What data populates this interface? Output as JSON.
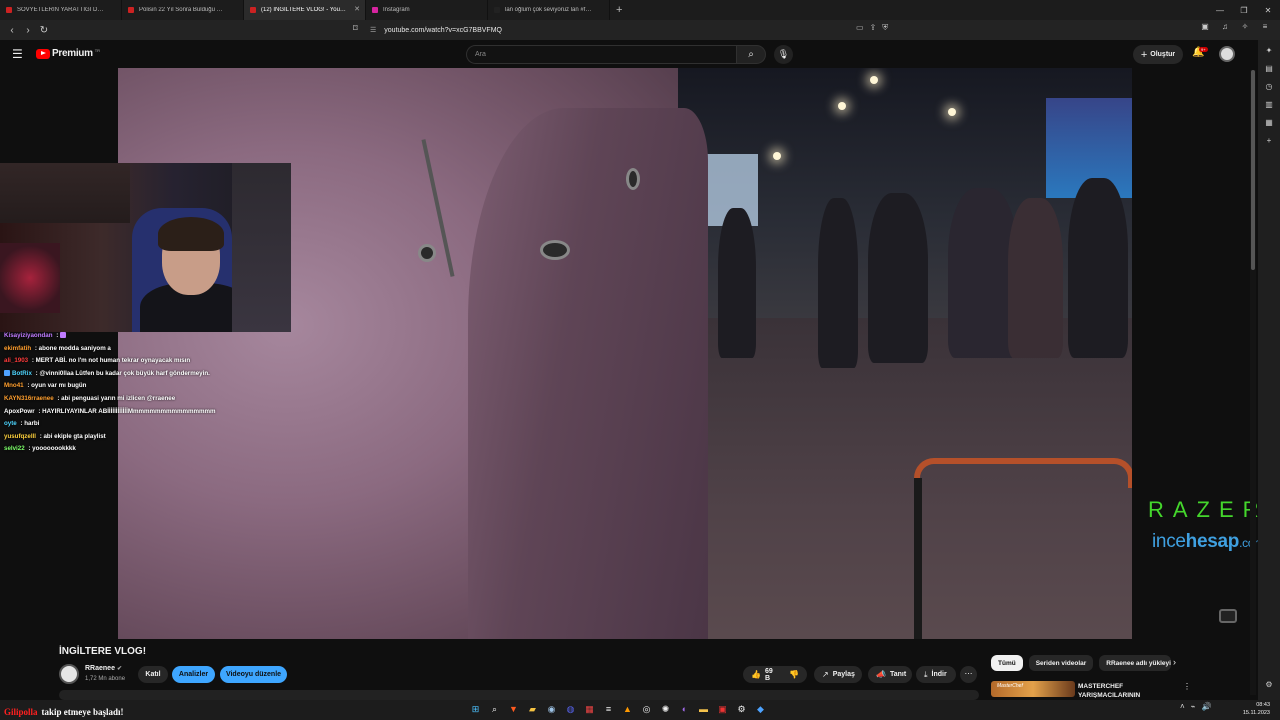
{
  "browser": {
    "tabs": [
      {
        "title": "SOVYETLERİN YARATTIĞI DÜNYANIN...",
        "color": "#cc2222",
        "active": false
      },
      {
        "title": "Polisin 22 Yıl Sonra Bulduğu Gerçek ...",
        "color": "#cc2222",
        "active": false
      },
      {
        "title": "(12) İNGİLTERE VLOG! - YouTube",
        "color": "#cc2222",
        "active": true
      },
      {
        "title": "Instagram",
        "color": "#d6249f",
        "active": false
      },
      {
        "title": "lan oğlum çok seviyoruz lan #fyp #p...",
        "color": "#222222",
        "active": false
      }
    ],
    "url": "youtube.com/watch?v=xcG7BBVFMQ"
  },
  "header": {
    "logo_text": "Premium",
    "logo_sup": "TR",
    "search_placeholder": "Ara",
    "create_label": "Oluştur",
    "notif_count": "9+"
  },
  "overlay": {
    "chat": [
      {
        "user": "Kisayiziyaondan",
        "msg": "",
        "color": "#c07bff",
        "icon": ""
      },
      {
        "user": "ekimfatih",
        "msg": "abone modda saniyom a",
        "color": "#ff9f2e",
        "icon": ""
      },
      {
        "user": "ali_1903",
        "msg": "MERT ABİ. no I'm not human tekrar oynayacak mısın",
        "color": "#ff3b3b",
        "icon": ""
      },
      {
        "user": "BotRix",
        "msg": "@vinni0llaa Lütfen bu kadar çok büyük harf göndermeyin.",
        "color": "#4fd6ff",
        "icon": "bot"
      },
      {
        "user": "Mno41",
        "msg": "oyun var mı bugün",
        "color": "#ff9f2e",
        "icon": ""
      },
      {
        "user": "KAYN316rraenee",
        "msg": "abi penguasi yarın mi izlicen @rraenee",
        "color": "#ff9f2e",
        "icon": ""
      },
      {
        "user": "ApoxPowr",
        "msg": "HAYIRLIYAYINLAR ABİİİİİİİİİİİİMmmmmmmmmmmmmmmm",
        "color": "#ffffff",
        "icon": ""
      },
      {
        "user": "oyte",
        "msg": "harbi",
        "color": "#4fd6ff",
        "icon": ""
      },
      {
        "user": "yusufqzelll",
        "msg": "abi ekiple gta playlist",
        "color": "#ffd23e",
        "icon": ""
      },
      {
        "user": "selvi22",
        "msg": "yoooooookkkk",
        "color": "#7dff6a",
        "icon": ""
      }
    ],
    "sponsor1": "RAZER",
    "sponsor2_a": "ince",
    "sponsor2_b": "hesap",
    "sponsor2_c": ".com"
  },
  "video": {
    "title": "İNGİLTERE VLOG!",
    "channel": "RRaenee",
    "subscribers": "1,72 Mn abone",
    "buttons": {
      "join": "Katıl",
      "analytics": "Analizler",
      "edit": "Videoyu düzenle"
    },
    "likes": "69 B",
    "share": "Paylaş",
    "promote": "Tanıt",
    "download": "İndir"
  },
  "sidebar_chips": [
    "Tümü",
    "Seriden videolar",
    "RRaenee adlı yükleyici"
  ],
  "recommendation": {
    "title": "MASTERCHEF YARIŞMACILARININ",
    "thumb_label": "MasterChef"
  },
  "taskbar": {
    "notification_user": "Gilipolla",
    "notification_text": "takip etmeye başladı!",
    "time": "08:43",
    "date": "15.11.2023"
  }
}
